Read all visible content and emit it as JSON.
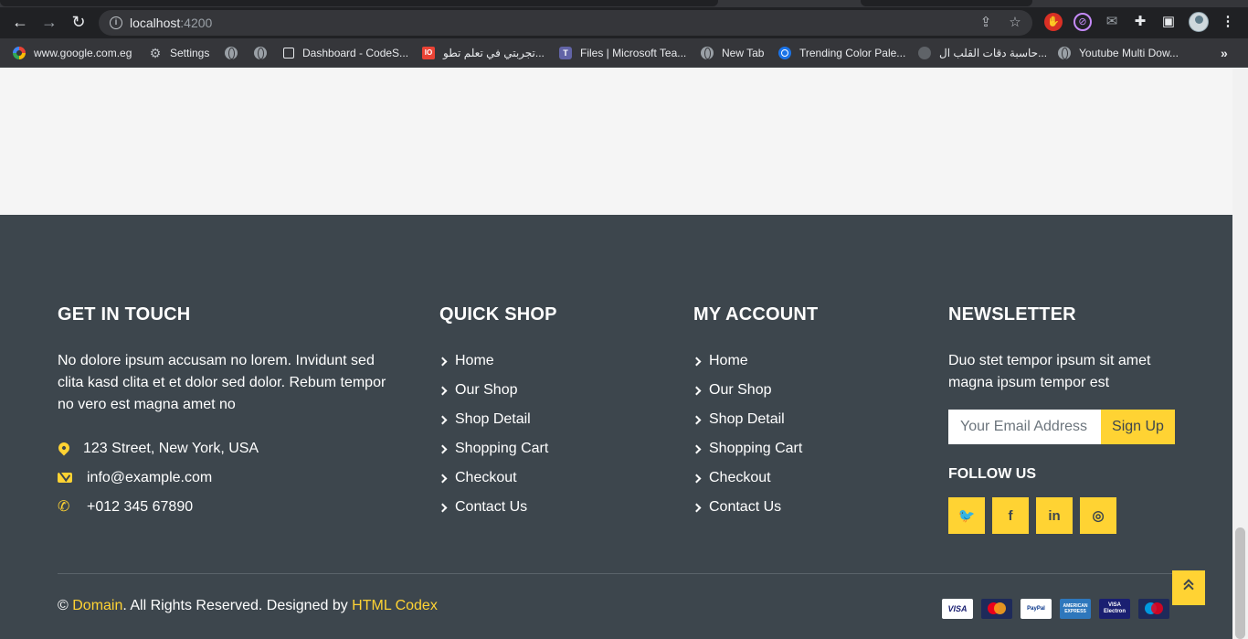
{
  "browser": {
    "url_host": "localhost",
    "url_port": ":4200",
    "bookmarks": [
      {
        "label": "www.google.com.eg",
        "icon": "google-icon"
      },
      {
        "label": "Settings",
        "icon": "gear-icon"
      },
      {
        "label": "",
        "icon": "globe-icon"
      },
      {
        "label": "",
        "icon": "globe-icon"
      },
      {
        "label": "Dashboard - CodeS...",
        "icon": "page-icon"
      },
      {
        "label": "تجربتي في تعلم تطو...",
        "icon": "io-icon"
      },
      {
        "label": "Files | Microsoft Tea...",
        "icon": "teams-icon"
      },
      {
        "label": "New Tab",
        "icon": "globe-icon"
      },
      {
        "label": "Trending Color Pale...",
        "icon": "color-icon"
      },
      {
        "label": "حاسبة دقات القلب ال...",
        "icon": "heart-icon"
      },
      {
        "label": "Youtube Multi Dow...",
        "icon": "globe-icon"
      }
    ],
    "more_label": "»"
  },
  "footer": {
    "touch": {
      "title": "GET IN TOUCH",
      "text": "No dolore ipsum accusam no lorem. Invidunt sed clita kasd clita et et dolor sed dolor. Rebum tempor no vero est magna amet no",
      "address": "123 Street, New York, USA",
      "email": "info@example.com",
      "phone": "+012 345 67890"
    },
    "quick_shop": {
      "title": "QUICK SHOP",
      "links": [
        "Home",
        "Our Shop",
        "Shop Detail",
        "Shopping Cart",
        "Checkout",
        "Contact Us"
      ]
    },
    "my_account": {
      "title": "MY ACCOUNT",
      "links": [
        "Home",
        "Our Shop",
        "Shop Detail",
        "Shopping Cart",
        "Checkout",
        "Contact Us"
      ]
    },
    "newsletter": {
      "title": "NEWSLETTER",
      "text": "Duo stet tempor ipsum sit amet magna ipsum tempor est",
      "input_placeholder": "Your Email Address",
      "button_label": "Sign Up",
      "follow_title": "FOLLOW US",
      "socials": [
        {
          "name": "twitter-icon",
          "glyph": "🐦"
        },
        {
          "name": "facebook-icon",
          "glyph": "f"
        },
        {
          "name": "linkedin-icon",
          "glyph": "in"
        },
        {
          "name": "instagram-icon",
          "glyph": "◎"
        }
      ]
    },
    "copyright": {
      "prefix": "© ",
      "domain": "Domain",
      "middle": ". All Rights Reserved. Designed by ",
      "designer": "HTML Codex"
    },
    "payments": [
      {
        "name": "visa-card-icon",
        "label": "VISA"
      },
      {
        "name": "mastercard-icon",
        "label": ""
      },
      {
        "name": "paypal-icon",
        "label": "PayPal"
      },
      {
        "name": "amex-icon",
        "label": "AMERICAN EXPRESS"
      },
      {
        "name": "visa-electron-icon",
        "label": "VISA Electron"
      },
      {
        "name": "maestro-icon",
        "label": ""
      }
    ]
  },
  "colors": {
    "accent": "#ffd333",
    "footer_bg": "#3d464d",
    "page_bg": "#f5f5f5"
  }
}
